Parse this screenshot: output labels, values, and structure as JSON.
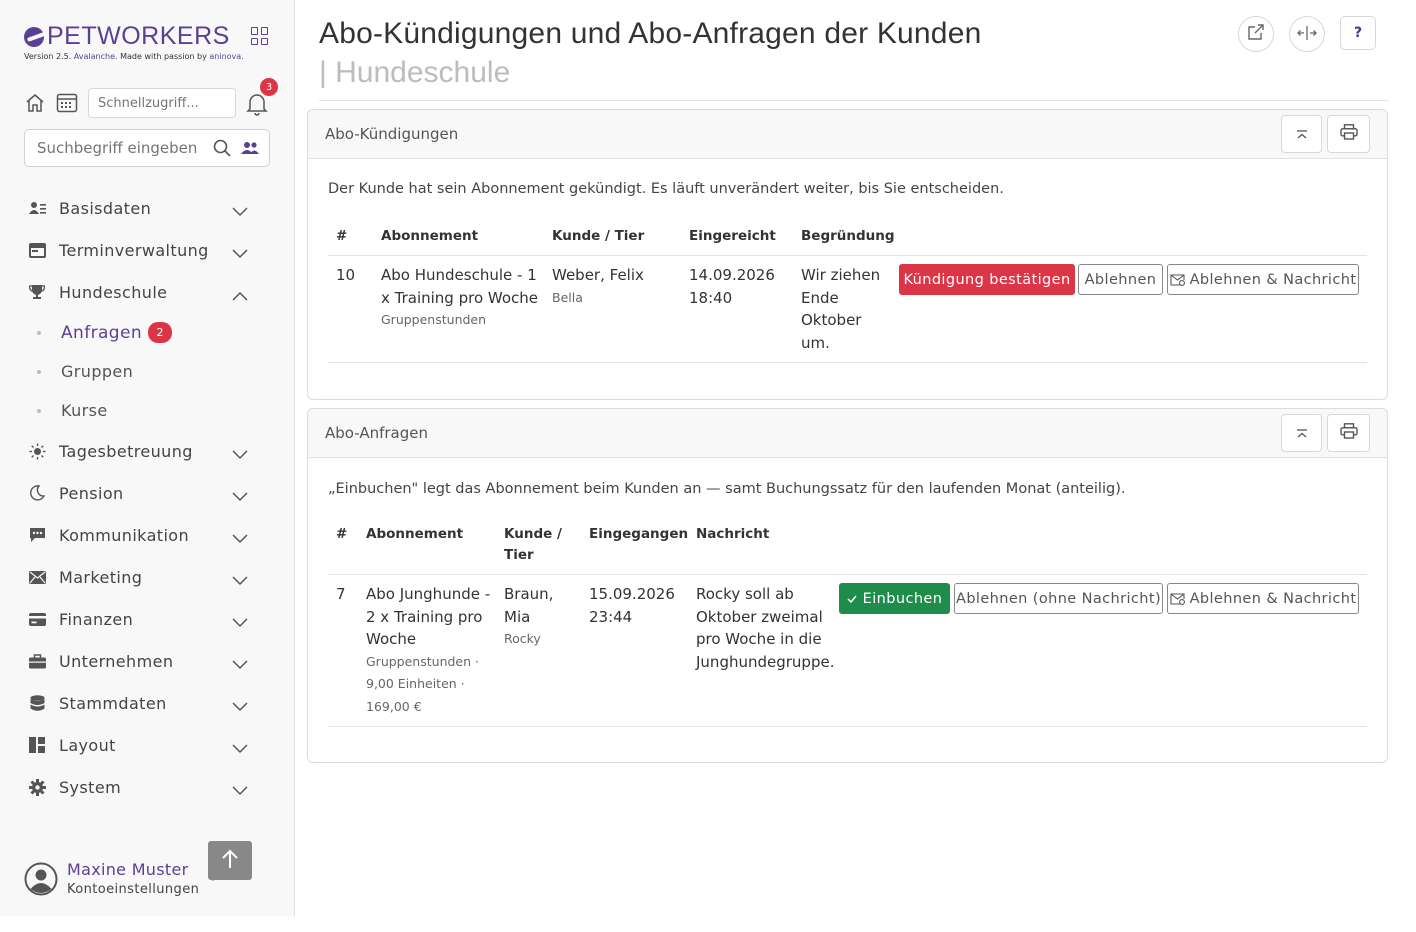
{
  "brand": {
    "name": "PETWORKERS",
    "version_prefix": "Version 2.5.",
    "version_name": "Avalanche.",
    "made_with": "Made with passion by",
    "maker": "aninova."
  },
  "quick_access": {
    "placeholder": "Schnellzugriff...",
    "notification_count": "3"
  },
  "search": {
    "placeholder": "Suchbegriff eingeben"
  },
  "nav": {
    "basisdaten": "Basisdaten",
    "terminverwaltung": "Terminverwaltung",
    "hundeschule": "Hundeschule",
    "anfragen": "Anfragen",
    "anfragen_badge": "2",
    "gruppen": "Gruppen",
    "kurse": "Kurse",
    "tagesbetreuung": "Tagesbetreuung",
    "pension": "Pension",
    "kommunikation": "Kommunikation",
    "marketing": "Marketing",
    "finanzen": "Finanzen",
    "unternehmen": "Unternehmen",
    "stammdaten": "Stammdaten",
    "layout": "Layout",
    "system": "System"
  },
  "user": {
    "name": "Maxine Muster",
    "settings": "Kontoeinstellungen"
  },
  "page": {
    "title": "Abo-Kündigungen und Abo-Anfragen der Kunden",
    "subtitle": "| Hundeschule",
    "help_label": "?"
  },
  "cancellations": {
    "title": "Abo-Kündigungen",
    "intro": "Der Kunde hat sein Abonnement gekündigt. Es läuft unverändert weiter, bis Sie entscheiden.",
    "columns": {
      "num": "#",
      "abo": "Abonnement",
      "kunde": "Kunde / Tier",
      "date": "Eingereicht",
      "reason": "Begründung"
    },
    "rows": [
      {
        "num": "10",
        "abo_line1": "Abo Hundeschule - 1",
        "abo_line2": "x Training pro Woche",
        "abo_detail": "Gruppenstunden",
        "customer": "Weber, Felix",
        "pet": "Bella",
        "date": "14.09.2026",
        "time": "18:40",
        "reason_l1": "Wir ziehen",
        "reason_l2": "Ende",
        "reason_l3": "Oktober",
        "reason_l4": "um.",
        "btn_confirm": "Kündigung bestätigen",
        "btn_reject": "Ablehnen",
        "btn_reject_msg": "Ablehnen & Nachricht"
      }
    ]
  },
  "requests": {
    "title": "Abo-Anfragen",
    "intro": "„Einbuchen\" legt das Abonnement beim Kunden an — samt Buchungssatz für den laufenden Monat (anteilig).",
    "columns": {
      "num": "#",
      "abo": "Abonnement",
      "kunde_l1": "Kunde /",
      "kunde_l2": "Tier",
      "date": "Eingegangen",
      "message": "Nachricht"
    },
    "rows": [
      {
        "num": "7",
        "abo_line1": "Abo Junghunde -",
        "abo_line2": "2 x Training pro",
        "abo_line3": "Woche",
        "detail_l1": "Gruppenstunden ·",
        "detail_l2": "9,00 Einheiten ·",
        "detail_l3": "169,00 €",
        "customer_l1": "Braun,",
        "customer_l2": "Mia",
        "pet": "Rocky",
        "date": "15.09.2026",
        "time": "23:44",
        "msg_l1": "Rocky soll ab",
        "msg_l2": "Oktober zweimal",
        "msg_l3": "pro Woche in die",
        "msg_l4": "Junghundegruppe.",
        "btn_book": "Einbuchen",
        "btn_reject": "Ablehnen (ohne Nachricht)",
        "btn_reject_msg": "Ablehnen & Nachricht"
      }
    ]
  },
  "colors": {
    "brand": "#5b3f95",
    "danger": "#dc3545",
    "success": "#1e8c4b"
  }
}
